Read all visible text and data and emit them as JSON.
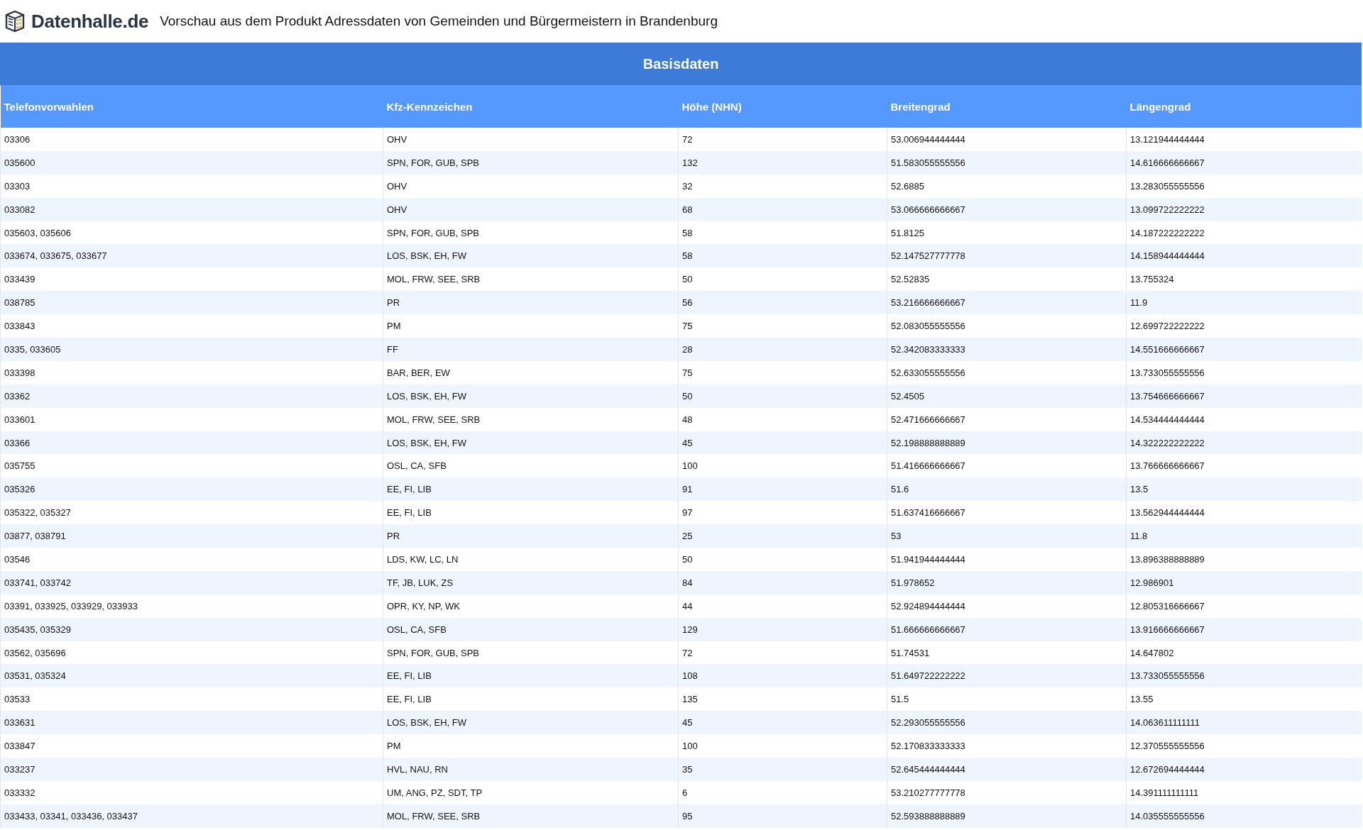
{
  "header": {
    "logo": "Datenhalle.de",
    "title": "Vorschau aus dem Produkt Adressdaten von Gemeinden und Bürgermeistern in Brandenburg"
  },
  "table": {
    "caption": "Basisdaten",
    "columns": [
      "Telefonvorwahlen",
      "Kfz-Kennzeichen",
      "Höhe (NHN)",
      "Breitengrad",
      "Längengrad"
    ],
    "rows": [
      [
        "03306",
        "OHV",
        "72",
        "53.006944444444",
        "13.121944444444"
      ],
      [
        "035600",
        "SPN, FOR, GUB, SPB",
        "132",
        "51.583055555556",
        "14.616666666667"
      ],
      [
        "03303",
        "OHV",
        "32",
        "52.6885",
        "13.283055555556"
      ],
      [
        "033082",
        "OHV",
        "68",
        "53.066666666667",
        "13.099722222222"
      ],
      [
        "035603, 035606",
        "SPN, FOR, GUB, SPB",
        "58",
        "51.8125",
        "14.187222222222"
      ],
      [
        "033674, 033675, 033677",
        "LOS, BSK, EH, FW",
        "58",
        "52.147527777778",
        "14.158944444444"
      ],
      [
        "033439",
        "MOL, FRW, SEE, SRB",
        "50",
        "52.52835",
        "13.755324"
      ],
      [
        "038785",
        "PR",
        "56",
        "53.216666666667",
        "11.9"
      ],
      [
        "033843",
        "PM",
        "75",
        "52.083055555556",
        "12.699722222222"
      ],
      [
        "0335, 033605",
        "FF",
        "28",
        "52.342083333333",
        "14.551666666667"
      ],
      [
        "033398",
        "BAR, BER, EW",
        "75",
        "52.633055555556",
        "13.733055555556"
      ],
      [
        "03362",
        "LOS, BSK, EH, FW",
        "50",
        "52.4505",
        "13.754666666667"
      ],
      [
        "033601",
        "MOL, FRW, SEE, SRB",
        "48",
        "52.471666666667",
        "14.534444444444"
      ],
      [
        "03366",
        "LOS, BSK, EH, FW",
        "45",
        "52.198888888889",
        "14.322222222222"
      ],
      [
        "035755",
        "OSL, CA, SFB",
        "100",
        "51.416666666667",
        "13.766666666667"
      ],
      [
        "035326",
        "EE, FI, LIB",
        "91",
        "51.6",
        "13.5"
      ],
      [
        "035322, 035327",
        "EE, FI, LIB",
        "97",
        "51.637416666667",
        "13.562944444444"
      ],
      [
        "03877, 038791",
        "PR",
        "25",
        "53",
        "11.8"
      ],
      [
        "03546",
        "LDS, KW, LC, LN",
        "50",
        "51.941944444444",
        "13.896388888889"
      ],
      [
        "033741, 033742",
        "TF, JB, LUK, ZS",
        "84",
        "51.978652",
        "12.986901"
      ],
      [
        "03391, 033925, 033929, 033933",
        "OPR, KY, NP, WK",
        "44",
        "52.924894444444",
        "12.805316666667"
      ],
      [
        "035435, 035329",
        "OSL, CA, SFB",
        "129",
        "51.666666666667",
        "13.916666666667"
      ],
      [
        "03562, 035696",
        "SPN, FOR, GUB, SPB",
        "72",
        "51.74531",
        "14.647802"
      ],
      [
        "03531, 035324",
        "EE, FI, LIB",
        "108",
        "51.649722222222",
        "13.733055555556"
      ],
      [
        "03533",
        "EE, FI, LIB",
        "135",
        "51.5",
        "13.55"
      ],
      [
        "033631",
        "LOS, BSK, EH, FW",
        "45",
        "52.293055555556",
        "14.063611111111"
      ],
      [
        "033847",
        "PM",
        "100",
        "52.170833333333",
        "12.370555555556"
      ],
      [
        "033237",
        "HVL, NAU, RN",
        "35",
        "52.645444444444",
        "12.672694444444"
      ],
      [
        "033332",
        "UM, ANG, PZ, SDT, TP",
        "6",
        "53.210277777778",
        "14.391111111111"
      ],
      [
        "033433, 03341, 033436, 033437",
        "MOL, FRW, SEE, SRB",
        "95",
        "52.593888888889",
        "14.035555555556"
      ]
    ]
  }
}
